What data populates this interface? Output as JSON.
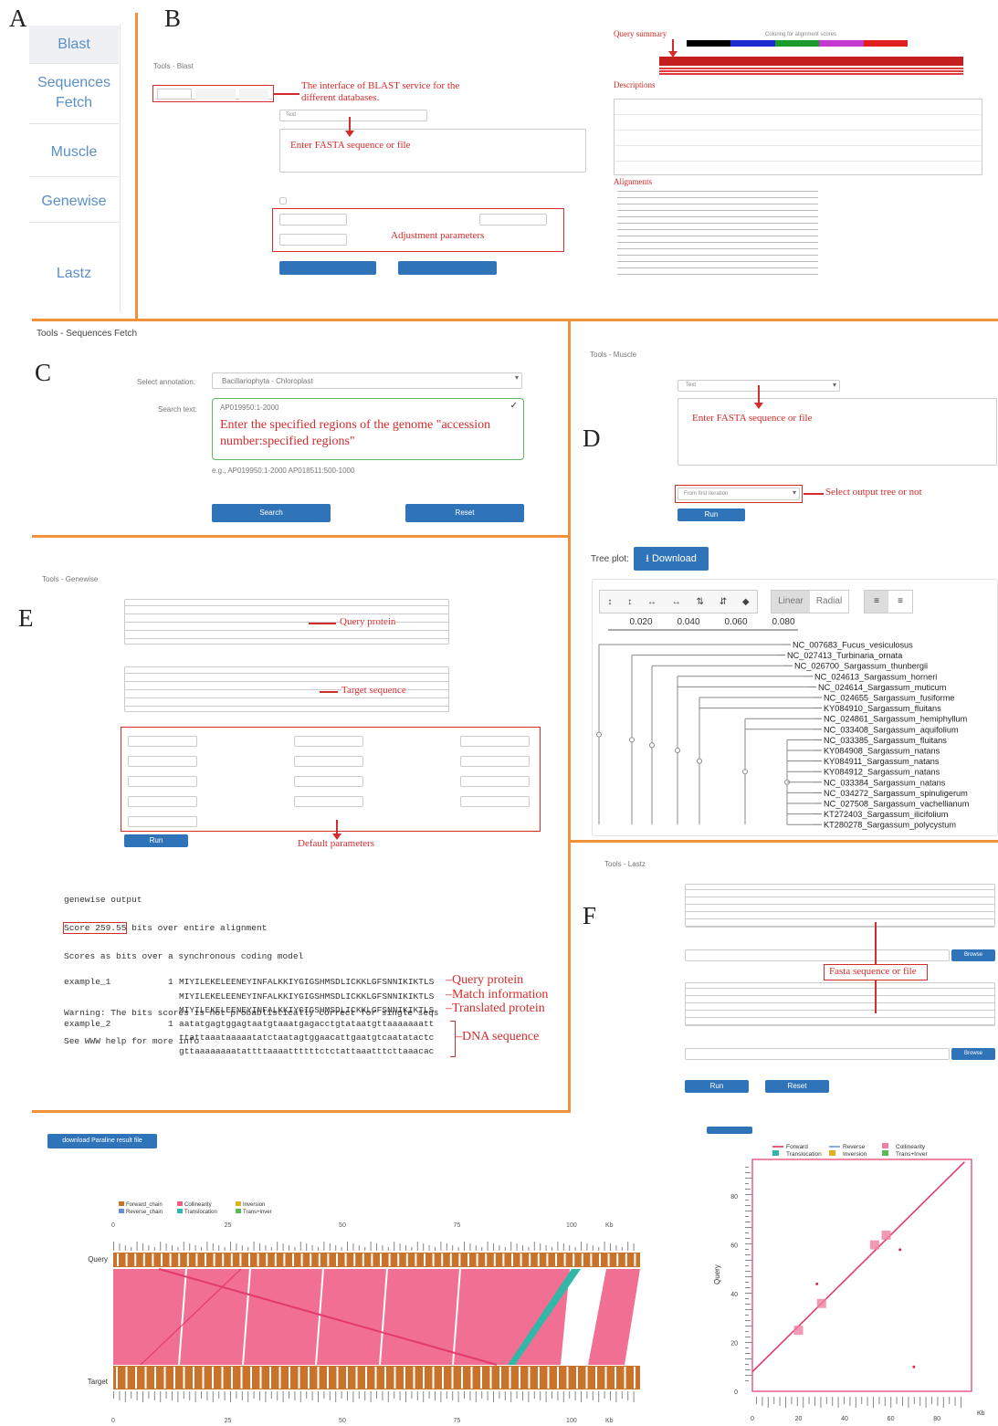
{
  "panel_labels": {
    "a": "A",
    "b": "B",
    "c": "C",
    "d": "D",
    "e": "E",
    "f": "F"
  },
  "sidebar": {
    "items": [
      "Blast",
      "Sequences Fetch",
      "Muscle",
      "Genewise",
      "Lastz"
    ]
  },
  "blast": {
    "breadcrumb": "Tools · Blast",
    "annotation_db": "The interface of BLAST service for the different databases.",
    "annotation_fasta": "Enter FASTA sequence or file",
    "annotation_params": "Adjustment parameters",
    "type_value": "Text",
    "result": {
      "query_summary": "Query summary",
      "color_key": "Coloring for alignment scores",
      "descriptions": "Descriptions",
      "alignments": "Alignments"
    }
  },
  "seqfetch": {
    "breadcrumb": "Tools - Sequences Fetch",
    "select_label": "Select annotation:",
    "select_value": "Bacillariophyta - Chloroplast",
    "search_label": "Search text:",
    "search_value": "AP019950:1-2000",
    "annotation": "Enter the specified regions of the genome \"accession number:specified regions\"",
    "example": "e.g., AP019950:1-2000 AP018511:500-1000",
    "search_btn": "Search",
    "reset_btn": "Reset"
  },
  "muscle": {
    "breadcrumb": "Tools - Muscle",
    "type_value": "Text",
    "annotation_fasta": "Enter FASTA sequence or file",
    "annotation_tree": "Select output tree or not",
    "output_tree_value": "From first iteration",
    "run_btn": "Run",
    "tree_plot_label": "Tree plot:",
    "download_btn": "Download",
    "linear": "Linear",
    "radial": "Radial",
    "scale": [
      "0.020",
      "0.040",
      "0.060",
      "0.080"
    ],
    "leaves": [
      "NC_007683_Fucus_vesiculosus",
      "NC_027413_Turbinaria_ornata",
      "NC_026700_Sargassum_thunbergii",
      "NC_024613_Sargassum_horneri",
      "NC_024614_Sargassum_muticum",
      "NC_024655_Sargassum_fusiforme",
      "KY084910_Sargassum_fluitans",
      "NC_024861_Sargassum_hemiphyllum",
      "NC_033408_Sargassum_aquifolium",
      "NC_033385_Sargassum_fluitans",
      "KY084908_Sargassum_natans",
      "KY084911_Sargassum_natans",
      "KY084912_Sargassum_natans",
      "NC_033384_Sargassum_natans",
      "NC_034272_Sargassum_spinuligerum",
      "NC_027508_Sargassum_vachellianum",
      "KT272403_Sargassum_ilicifolium",
      "KT280278_Sargassum_polycystum"
    ]
  },
  "genewise": {
    "breadcrumb": "Tools - Genewise",
    "annotation_query": "Query protein",
    "annotation_target": "Target sequence",
    "annotation_default": "Default parameters",
    "run_btn": "Run",
    "output": {
      "l1": "genewise output",
      "score": "Score 259.55",
      "l2": "bits over entire alignment",
      "l3": "Scores as bits over a synchronous coding model",
      "l4": "Warning: The bits scores is not probablistically correct for single seqs",
      "l5": "See WWW help for more info",
      "ex1": "example_1",
      "ex2": "example_2",
      "num1": "1",
      "prot": "MIYILEKELEENEYINFALKKIYGIGSHMSDLICKKLGFSNNIKIKTLS",
      "dna1": "aatatgagtggagtaatgtaaatgagacctgtataatgttaaaaaaatt",
      "dna2": "ttattaaataaaaatatctaatagtggaacattgaatgtcaatatactc",
      "dna3": "gttaaaaaaaatattttaaaattttttctctattaaatttcttaaacac"
    },
    "tags": {
      "query": "Query protein",
      "match": "Match information",
      "translated": "Translated protein",
      "dna": "DNA sequence"
    }
  },
  "lastz": {
    "breadcrumb": "Tools - Lastz",
    "annotation": "Fasta sequence or file",
    "run_btn": "Run",
    "reset_btn": "Reset",
    "browse": "Browse"
  },
  "bottom": {
    "download_btn": "download Paraline result file",
    "legend": [
      "Forward_chain",
      "Reverse_chain",
      "Collinearity",
      "Translocation",
      "Inversion",
      "Trans+inver"
    ],
    "query_label": "Query",
    "target_label": "Target",
    "ticks": [
      "0",
      "25",
      "50",
      "75",
      "100"
    ],
    "kb": "Kb",
    "dot_legend": [
      "Forward",
      "Reverse",
      "Collinearity",
      "Translocation",
      "Inversion",
      "Trans+Inver"
    ],
    "dot_y_label": "Query",
    "dot_yticks": [
      "0",
      "20",
      "40",
      "60",
      "80"
    ],
    "dot_xticks": [
      "0",
      "20",
      "40",
      "60",
      "80"
    ]
  },
  "colors": {
    "orange": "#f0913a",
    "red": "#d42b2b",
    "blue": "#2f74b8",
    "pink": "#ef5f86",
    "teal": "#2fb8a8",
    "brown": "#c8722a"
  }
}
